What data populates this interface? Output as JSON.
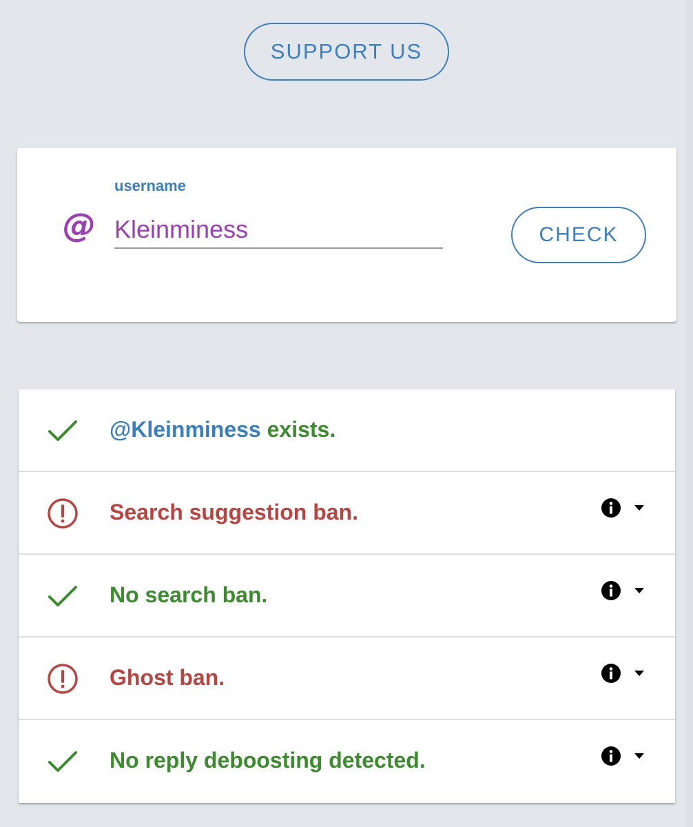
{
  "colors": {
    "background": "#e3e7ec",
    "accent_blue": "#3a7fc0",
    "purple": "#9a3fb4",
    "success_green": "#3d8b2f",
    "error_red": "#b84540"
  },
  "header": {
    "support_label": "SUPPORT US"
  },
  "search": {
    "at_symbol": "@",
    "field_label": "username",
    "username_value": "Kleinminess",
    "check_label": "CHECK"
  },
  "results": [
    {
      "status": "ok",
      "icon": "checkmark-icon",
      "handle": "@Kleinminess",
      "text": " exists.",
      "has_info": false
    },
    {
      "status": "bad",
      "icon": "alert-circle-icon",
      "text": "Search suggestion ban.",
      "has_info": true
    },
    {
      "status": "ok",
      "icon": "checkmark-icon",
      "text": "No search ban.",
      "has_info": true
    },
    {
      "status": "bad",
      "icon": "alert-circle-icon",
      "text": "Ghost ban.",
      "has_info": true
    },
    {
      "status": "ok",
      "icon": "checkmark-icon",
      "text": "No reply deboosting detected.",
      "has_info": true
    }
  ]
}
